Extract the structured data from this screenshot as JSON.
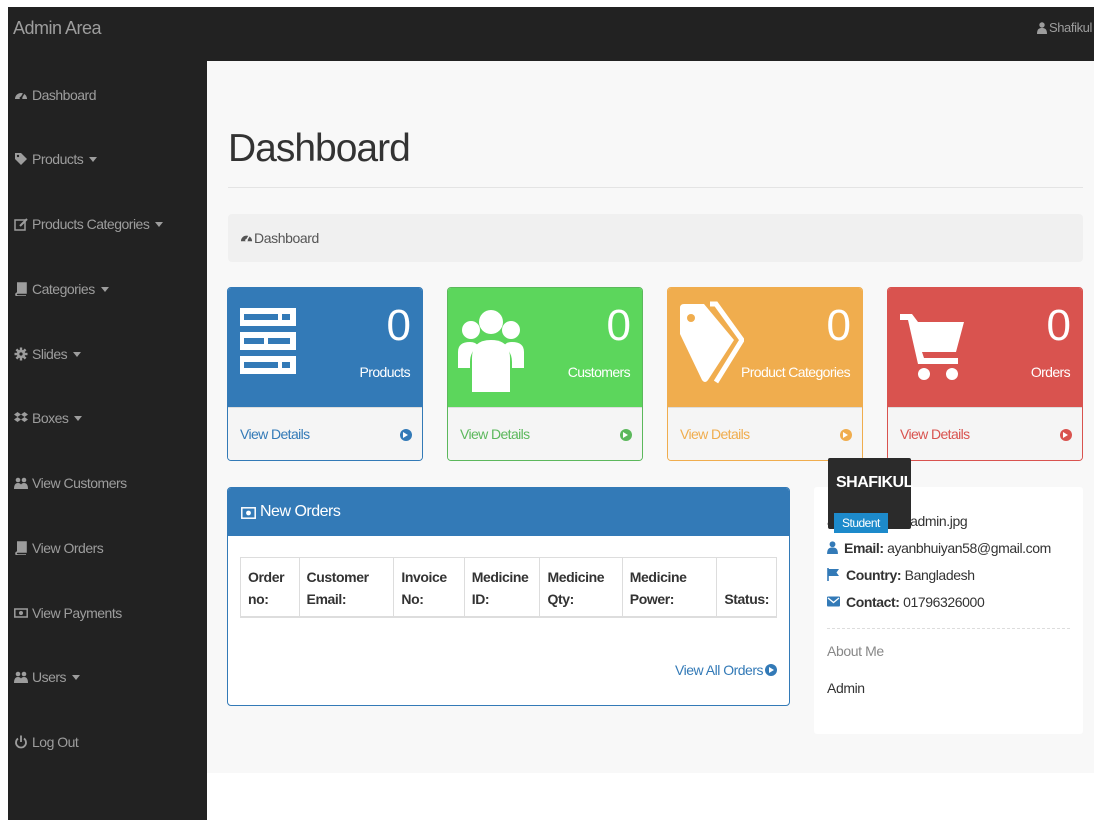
{
  "navbar": {
    "brand": "Admin Area",
    "user": "Shafikul",
    "user_icon": "user-icon"
  },
  "sidebar": {
    "items": [
      {
        "label": "Dashboard",
        "icon": "dashboard-icon",
        "dropdown": false
      },
      {
        "label": "Products",
        "icon": "tag-icon",
        "dropdown": true
      },
      {
        "label": "Products Categories",
        "icon": "edit-icon",
        "dropdown": true
      },
      {
        "label": "Categories",
        "icon": "book-icon",
        "dropdown": true
      },
      {
        "label": "Slides",
        "icon": "cog-icon",
        "dropdown": true
      },
      {
        "label": "Boxes",
        "icon": "dropbox-icon",
        "dropdown": true
      },
      {
        "label": "View Customers",
        "icon": "users-icon",
        "dropdown": false
      },
      {
        "label": "View Orders",
        "icon": "book-icon",
        "dropdown": false
      },
      {
        "label": "View Payments",
        "icon": "money-icon",
        "dropdown": false
      },
      {
        "label": "Users",
        "icon": "users-icon",
        "dropdown": true
      },
      {
        "label": "Log Out",
        "icon": "power-icon",
        "dropdown": false
      }
    ]
  },
  "main": {
    "title": "Dashboard",
    "breadcrumb": "Dashboard"
  },
  "stats": [
    {
      "count": "0",
      "label": "Products",
      "link": "View Details",
      "icon": "tasks-icon",
      "color": "#337ab7"
    },
    {
      "count": "0",
      "label": "Customers",
      "link": "View Details",
      "icon": "users-icon",
      "color": "#5cd65c"
    },
    {
      "count": "0",
      "label": "Product Categories",
      "link": "View Details",
      "icon": "tags-icon",
      "color": "#f0ad4e"
    },
    {
      "count": "0",
      "label": "Orders",
      "link": "View Details",
      "icon": "shopping-cart-icon",
      "color": "#d9534f"
    }
  ],
  "orders": {
    "title": "New Orders",
    "columns": [
      "Order no:",
      "Customer Email:",
      "Invoice No:",
      "Medicine ID:",
      "Medicine Qty:",
      "Medicine Power:",
      "Status:"
    ],
    "view_all": "View All Orders"
  },
  "profile": {
    "name": "SHAFIKUL",
    "role": "Student",
    "image_path": "admin_image/admin.jpg",
    "email_label": "Email:",
    "email": "ayanbhuiyan58@gmail.com",
    "country_label": "Country:",
    "country": "Bangladesh",
    "contact_label": "Contact:",
    "contact": "01796326000",
    "about_heading": "About Me",
    "about_text": "Admin"
  }
}
